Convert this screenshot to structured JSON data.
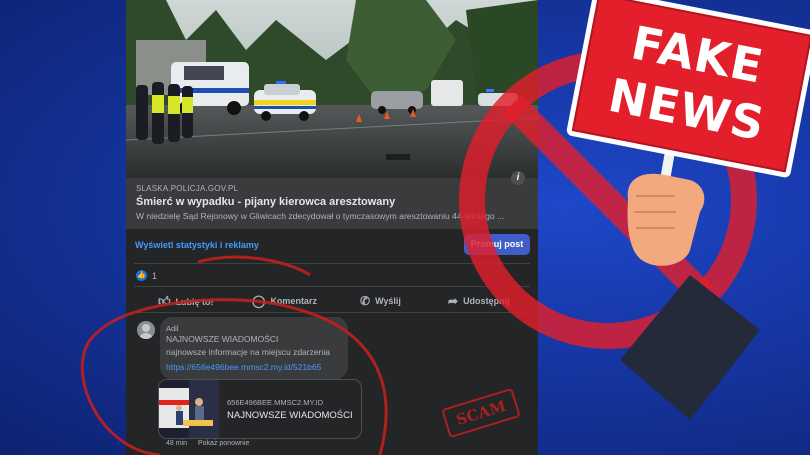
{
  "post": {
    "link_domain": "SLASKA.POLICJA.GOV.PL",
    "link_title": "Śmierć w wypadku - pijany kierowca aresztowany",
    "link_description": "W niedzielę Sąd Rejonowy w Gliwicach zdecydował o tymczasowym aresztowaniu 44-letniego ...",
    "info_icon": "i",
    "stats_link": "Wyświetl statystyki i reklamy",
    "promote_button": "Promuj post",
    "like_count": "1"
  },
  "actions": {
    "like": "Lubię to!",
    "comment": "Komentarz",
    "send": "Wyślij",
    "share": "Udostępnij"
  },
  "comment": {
    "author": "Adil",
    "line1": "NAJNOWSZE WIADOMOŚCI",
    "line2": "najnowsze informacje na miejscu zdarzenia",
    "link": "https://656e496bee.mmsc2.my.id/521b65",
    "preview_domain": "656E496BEE.MMSC2.MY.ID",
    "preview_title": "NAJNOWSZE WIADOMOŚCI",
    "time": "48 min",
    "reply": "Pokaż ponownie"
  },
  "overlay": {
    "sign_line1": "FAKE",
    "sign_line2": "NEWS",
    "stamp": "SCAM"
  },
  "colors": {
    "background": "#1637a6",
    "panel": "#242526",
    "accent_blue": "#4599ff",
    "promote": "#3f5ec7",
    "warning_red": "#e21f2b"
  }
}
